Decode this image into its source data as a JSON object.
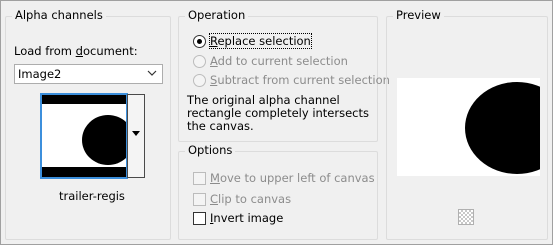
{
  "alpha_channels": {
    "title": "Alpha channels",
    "load_label_prefix": "Load from ",
    "load_label_underlined": "d",
    "load_label_suffix": "ocument:",
    "document_value": "Image2",
    "thumbnail_caption": "trailer-regis"
  },
  "operation": {
    "title": "Operation",
    "options": [
      {
        "underlined": "R",
        "rest": "eplace selection",
        "checked": true,
        "enabled": true
      },
      {
        "underlined": "A",
        "rest": "dd to current selection",
        "checked": false,
        "enabled": false
      },
      {
        "underlined": "S",
        "rest": "ubtract from current selection",
        "checked": false,
        "enabled": false
      }
    ],
    "message": "The original alpha channel rectangle completely intersects the canvas."
  },
  "options": {
    "title": "Options",
    "items": [
      {
        "underlined": "M",
        "rest": "ove to upper left of canvas",
        "checked": false,
        "enabled": false
      },
      {
        "underlined": "C",
        "rest": "lip to canvas",
        "checked": false,
        "enabled": false
      },
      {
        "underlined": "I",
        "rest": "nvert image",
        "checked": false,
        "enabled": true
      }
    ]
  },
  "preview": {
    "title": "Preview"
  },
  "colors": {
    "selection_border": "#3c8fdc",
    "disabled_text": "#8c8c8c",
    "shape_fill": "#000000"
  }
}
